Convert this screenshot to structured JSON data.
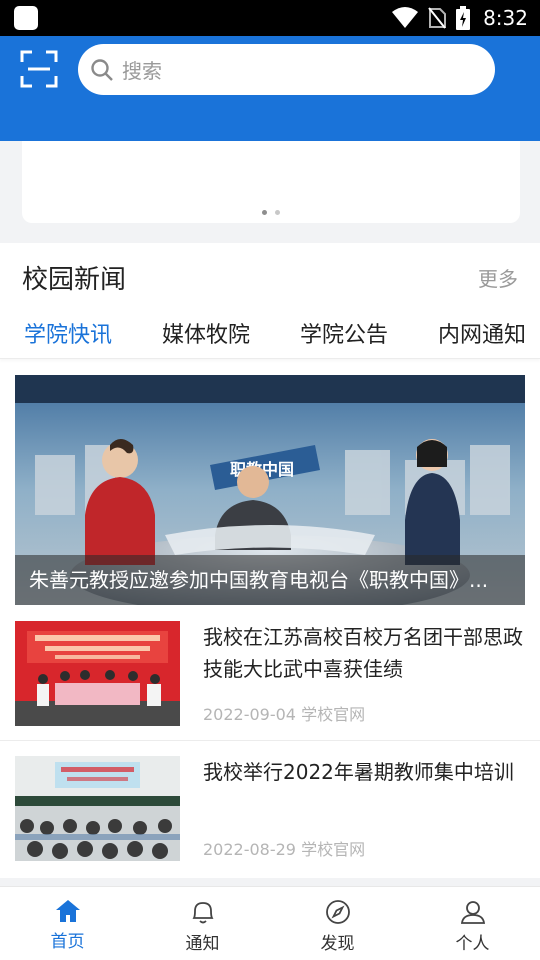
{
  "status_bar": {
    "time": "8:32"
  },
  "search": {
    "placeholder": "搜索"
  },
  "banner": {
    "page_count": 2,
    "active_index": 0
  },
  "news": {
    "title": "校园新闻",
    "more": "更多",
    "tabs": [
      "学院快讯",
      "媒体牧院",
      "学院公告",
      "内网通知"
    ],
    "active_tab": 0,
    "hero": {
      "caption": "朱善元教授应邀参加中国教育电视台《职教中国》..."
    },
    "items": [
      {
        "title": "我校在江苏高校百校万名团干部思政技能大比武中喜获佳绩",
        "date": "2022-09-04",
        "source": "学校官网"
      },
      {
        "title": "我校举行2022年暑期教师集中培训",
        "date": "2022-08-29",
        "source": "学校官网"
      }
    ]
  },
  "bottom_nav": [
    {
      "label": "首页",
      "icon": "home-icon",
      "active": true
    },
    {
      "label": "通知",
      "icon": "bell-icon",
      "active": false
    },
    {
      "label": "发现",
      "icon": "compass-icon",
      "active": false
    },
    {
      "label": "个人",
      "icon": "person-icon",
      "active": false
    }
  ],
  "colors": {
    "brand": "#1a73d9",
    "background": "#f2f3f5"
  }
}
